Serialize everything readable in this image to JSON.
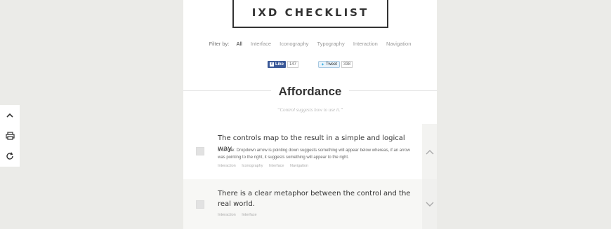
{
  "header": {
    "logo_text": "IXD CHECKLIST"
  },
  "filter": {
    "label": "Filter by:",
    "options": [
      "All",
      "Interface",
      "Iconography",
      "Typography",
      "Interaction",
      "Navigation"
    ],
    "active": "All"
  },
  "social": {
    "facebook": {
      "label": "Like",
      "count": "147"
    },
    "twitter": {
      "label": "Tweet",
      "count": "338"
    }
  },
  "section": {
    "title": "Affordance",
    "subtitle": "“Control suggests how to use it.”"
  },
  "items": [
    {
      "title": "The controls map to the result in a simple and logical way.",
      "example": "Example: Dropdown arrow is pointing down suggests something will appear below whereas, if an arrow was pointing to the right, it suggests something will appear to the right.",
      "tags": [
        "Interaction",
        "Iconography",
        "Interface",
        "Navigation"
      ],
      "expanded": true
    },
    {
      "title": "There is a clear metaphor between the control and the real world.",
      "tags": [
        "Interaction",
        "Interface"
      ],
      "expanded": false
    }
  ],
  "side_tools": [
    "chevron-up-icon",
    "print-icon",
    "refresh-icon"
  ],
  "colors": {
    "background": "#ebebe8",
    "panel": "#ffffff",
    "text": "#333333",
    "muted": "#999999",
    "facebook": "#3b5998",
    "twitter": "#2aa9e0"
  }
}
